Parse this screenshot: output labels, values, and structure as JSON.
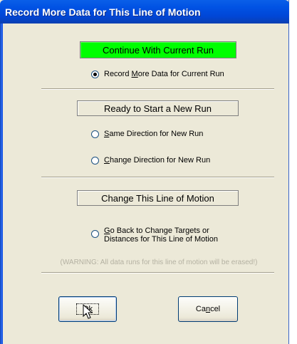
{
  "window": {
    "title": "Record More Data for This Line of Motion"
  },
  "continue_section": {
    "button_label": "Continue With Current Run",
    "button_color": "#00ff00",
    "record_option": {
      "pre": "Record ",
      "key": "M",
      "post": "ore Data for Current Run",
      "selected": true
    }
  },
  "new_run_section": {
    "header": "Ready to Start a New Run",
    "same_direction": {
      "pre": "",
      "key": "S",
      "post": "ame Direction for New Run",
      "selected": false
    },
    "change_direction": {
      "pre": "",
      "key": "C",
      "post": "hange Direction for New Run",
      "selected": false
    }
  },
  "line_section": {
    "header": "Change This Line of Motion",
    "go_back": {
      "line1_pre": "",
      "line1_key": "G",
      "line1_post": "o Back to Change Targets or",
      "line2": "Distances for This Line of Motion",
      "selected": false
    },
    "warning": "(WARNING: All data runs for this line of motion will be erased!)"
  },
  "buttons": {
    "ok": {
      "pre": "O",
      "key": "k",
      "post": ""
    },
    "cancel": {
      "pre": "Ca",
      "key": "n",
      "post": "cel"
    }
  },
  "icons": {
    "cursor": "mouse-pointer-icon"
  }
}
